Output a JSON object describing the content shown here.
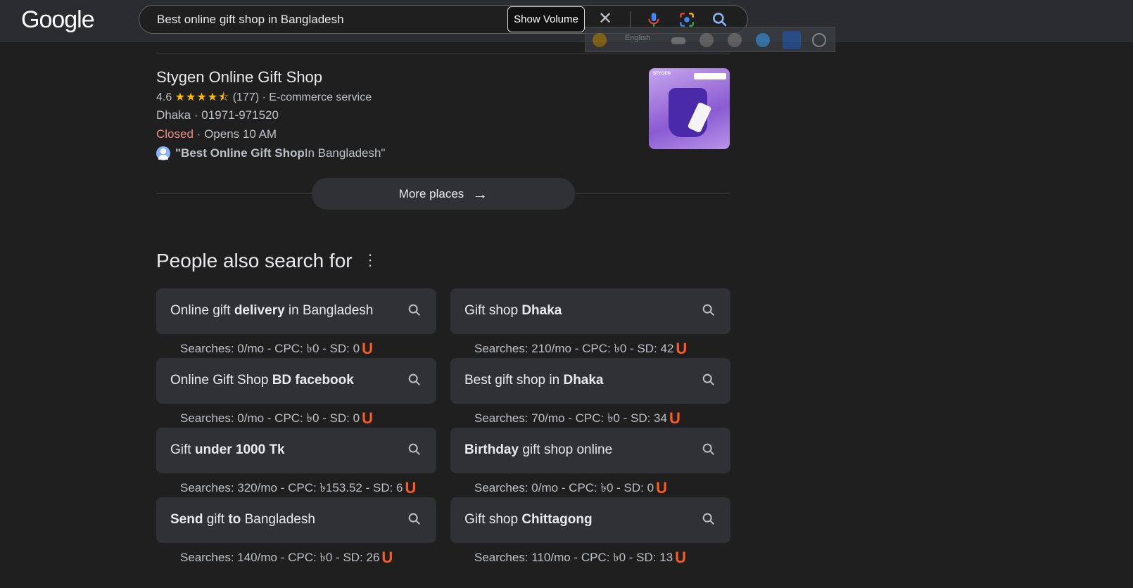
{
  "header": {
    "logo": "Google",
    "query": "Best online gift shop in Bangladesh",
    "show_volume_label": "Show Volume",
    "clear_icon": "close-icon",
    "toolbar": {
      "language": "English"
    }
  },
  "place": {
    "name": "Stygen Online Gift Shop",
    "rating": "4.6",
    "stars": "★★★★⯪",
    "review_count": "(177)",
    "category": "E-commerce service",
    "city": "Dhaka",
    "phone": "01971-971520",
    "status": "Closed",
    "opens": "Opens 10 AM",
    "review_quote_bold": "\"Best Online Gift Shop",
    "review_quote_rest": " In Bangladesh\"",
    "thumb_brand": "STYGEN"
  },
  "more_places_label": "More places",
  "people_also_search": {
    "title": "People also search for",
    "items": [
      {
        "parts": [
          [
            "Online gift ",
            false
          ],
          [
            "delivery",
            true
          ],
          [
            " in Bangladesh",
            false
          ]
        ],
        "stats": "Searches: 0/mo - CPC: ৳0 - SD: 0"
      },
      {
        "parts": [
          [
            "Gift shop ",
            false
          ],
          [
            "Dhaka",
            true
          ]
        ],
        "stats": "Searches: 210/mo - CPC: ৳0 - SD: 42"
      },
      {
        "parts": [
          [
            "Online Gift Shop ",
            false
          ],
          [
            "BD facebook",
            true
          ]
        ],
        "stats": "Searches: 0/mo - CPC: ৳0 - SD: 0"
      },
      {
        "parts": [
          [
            "Best gift shop in ",
            false
          ],
          [
            "Dhaka",
            true
          ]
        ],
        "stats": "Searches: 70/mo - CPC: ৳0 - SD: 34"
      },
      {
        "parts": [
          [
            "Gift ",
            false
          ],
          [
            "under 1000 Tk",
            true
          ]
        ],
        "stats": "Searches: 320/mo - CPC: ৳153.52 - SD: 6"
      },
      {
        "parts": [
          [
            "Birthday",
            true
          ],
          [
            " gift shop online",
            false
          ]
        ],
        "stats": "Searches: 0/mo - CPC: ৳0 - SD: 0"
      },
      {
        "parts": [
          [
            "Send",
            true
          ],
          [
            " gift ",
            false
          ],
          [
            "to",
            true
          ],
          [
            " Bangladesh",
            false
          ]
        ],
        "stats": "Searches: 140/mo - CPC: ৳0 - SD: 26"
      },
      {
        "parts": [
          [
            "Gift shop ",
            false
          ],
          [
            "Chittagong",
            true
          ]
        ],
        "stats": "Searches: 110/mo - CPC: ৳0 - SD: 13"
      }
    ],
    "badge": "U"
  }
}
